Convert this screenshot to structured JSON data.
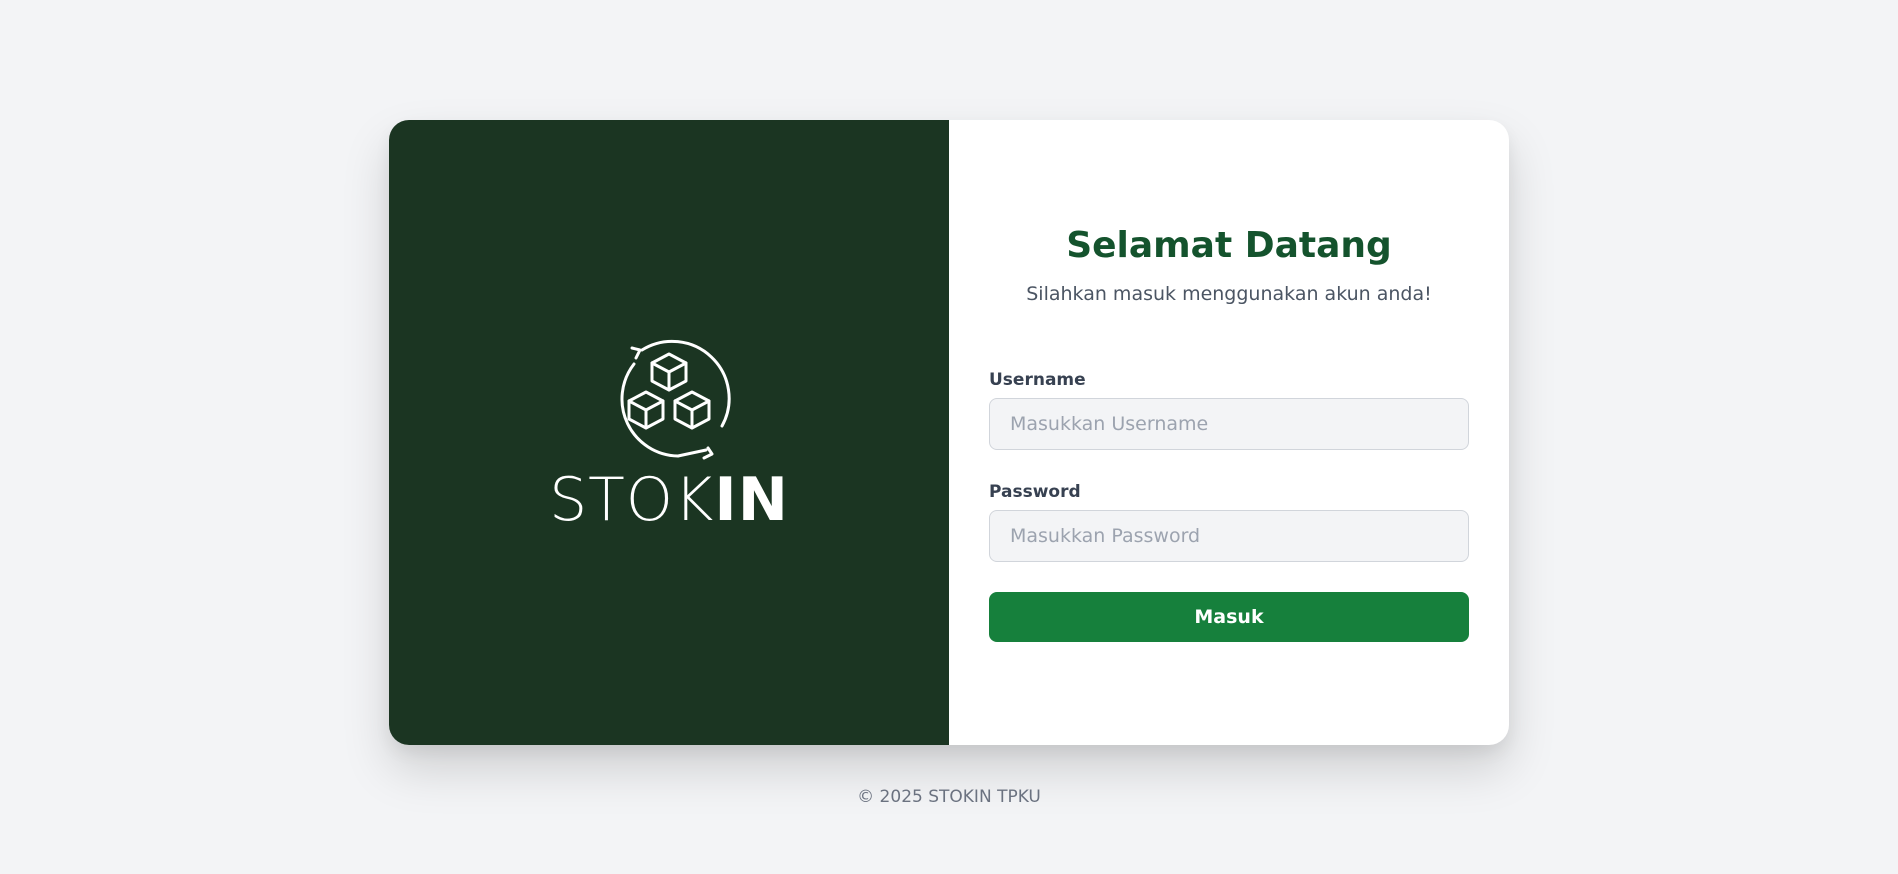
{
  "brand": {
    "logo_light": "STOK",
    "logo_bold": "IN",
    "logo_icon": "cubes-cycle-icon",
    "panel_color": "#1b3522"
  },
  "form": {
    "title": "Selamat Datang",
    "subtitle": "Silahkan masuk menggunakan akun anda!",
    "username_label": "Username",
    "username_placeholder": "Masukkan Username",
    "username_value": "",
    "password_label": "Password",
    "password_placeholder": "Masukkan Password",
    "password_value": "",
    "submit_label": "Masuk",
    "accent_color": "#16803c",
    "title_color": "#14532d"
  },
  "footer": {
    "text": "© 2025 STOKIN TPKU"
  }
}
